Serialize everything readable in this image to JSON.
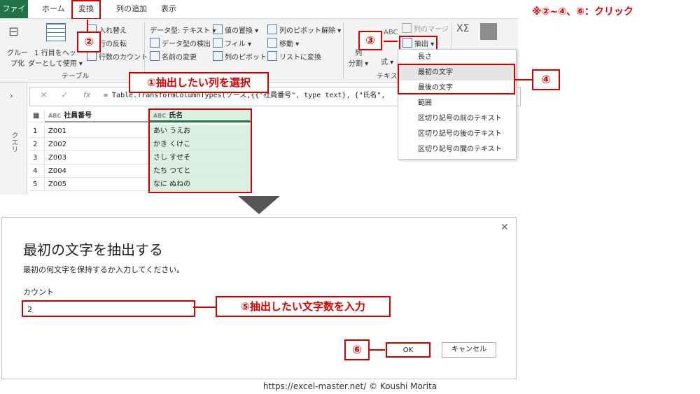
{
  "annotation_top": "※②~④、⑥：クリック",
  "tabs": [
    "ファイル",
    "ホーム",
    "変換",
    "列の追加",
    "表示"
  ],
  "ribbon": {
    "group_label_table": "テーブル",
    "group_label_text": "テキスト",
    "grouping": [
      "グルー",
      "プ化"
    ],
    "use_first_row": [
      "1 行目をヘッ",
      "ダーとして使用 ▾"
    ],
    "transpose": "入れ替え",
    "reverse_rows": "行の反転",
    "count_rows": "行数のカウント",
    "datatype": "データ型: テキスト ▾",
    "detect_type": "データ型の検出",
    "rename": "名前の変更",
    "replace_values": "値の置換 ▾",
    "fill": "フィル ▾",
    "pivot": "列のピボット",
    "unpivot": "列のピボット解除 ▾",
    "move": "移動 ▾",
    "to_list": "リストに変換",
    "split_col": [
      "列",
      "分割 ▾"
    ],
    "format": [
      "式 ▾"
    ],
    "merge_cols": "列のマージ",
    "extract": "抽出 ▾",
    "abc_glyph": "ABC",
    "stat_glyph": "XΣ"
  },
  "formula": {
    "cancel": "✕",
    "confirm": "✓",
    "fx": "fx",
    "text": "= Table.TransformColumnTypes(ソース,{{\"社員番号\", type text}, {\"氏名\","
  },
  "queries_label": "クエリ",
  "grid": {
    "columns": [
      "社員番号",
      "氏名"
    ],
    "col_type": "ABC",
    "rows": [
      {
        "n": "1",
        "id": "Z001",
        "name": "あい うえお"
      },
      {
        "n": "2",
        "id": "Z002",
        "name": "かき くけこ"
      },
      {
        "n": "3",
        "id": "Z003",
        "name": "さし すせそ"
      },
      {
        "n": "4",
        "id": "Z004",
        "name": "たち つてと"
      },
      {
        "n": "5",
        "id": "Z005",
        "name": "なに ぬねの"
      }
    ]
  },
  "dropdown_items": [
    "長さ",
    "最初の文字",
    "最後の文字",
    "範囲",
    "区切り記号の前のテキスト",
    "区切り記号の後のテキスト",
    "区切り記号の間のテキスト"
  ],
  "callouts": {
    "c1": "①抽出したい列を選択",
    "c2": "②",
    "c3": "③",
    "c4": "④",
    "c5": "⑤抽出したい文字数を入力",
    "c6": "⑥"
  },
  "dialog": {
    "title": "最初の文字を抽出する",
    "desc": "最初の何文字を保持するか入力してください。",
    "count_label": "カウント",
    "count_value": "2",
    "ok": "OK",
    "cancel": "キャンセル",
    "close": "✕"
  },
  "footer": "https://excel-master.net/  © Koushi Morita",
  "colors": {
    "accent": "#217346",
    "red": "#d40000",
    "selection": "#d9f0e3"
  }
}
